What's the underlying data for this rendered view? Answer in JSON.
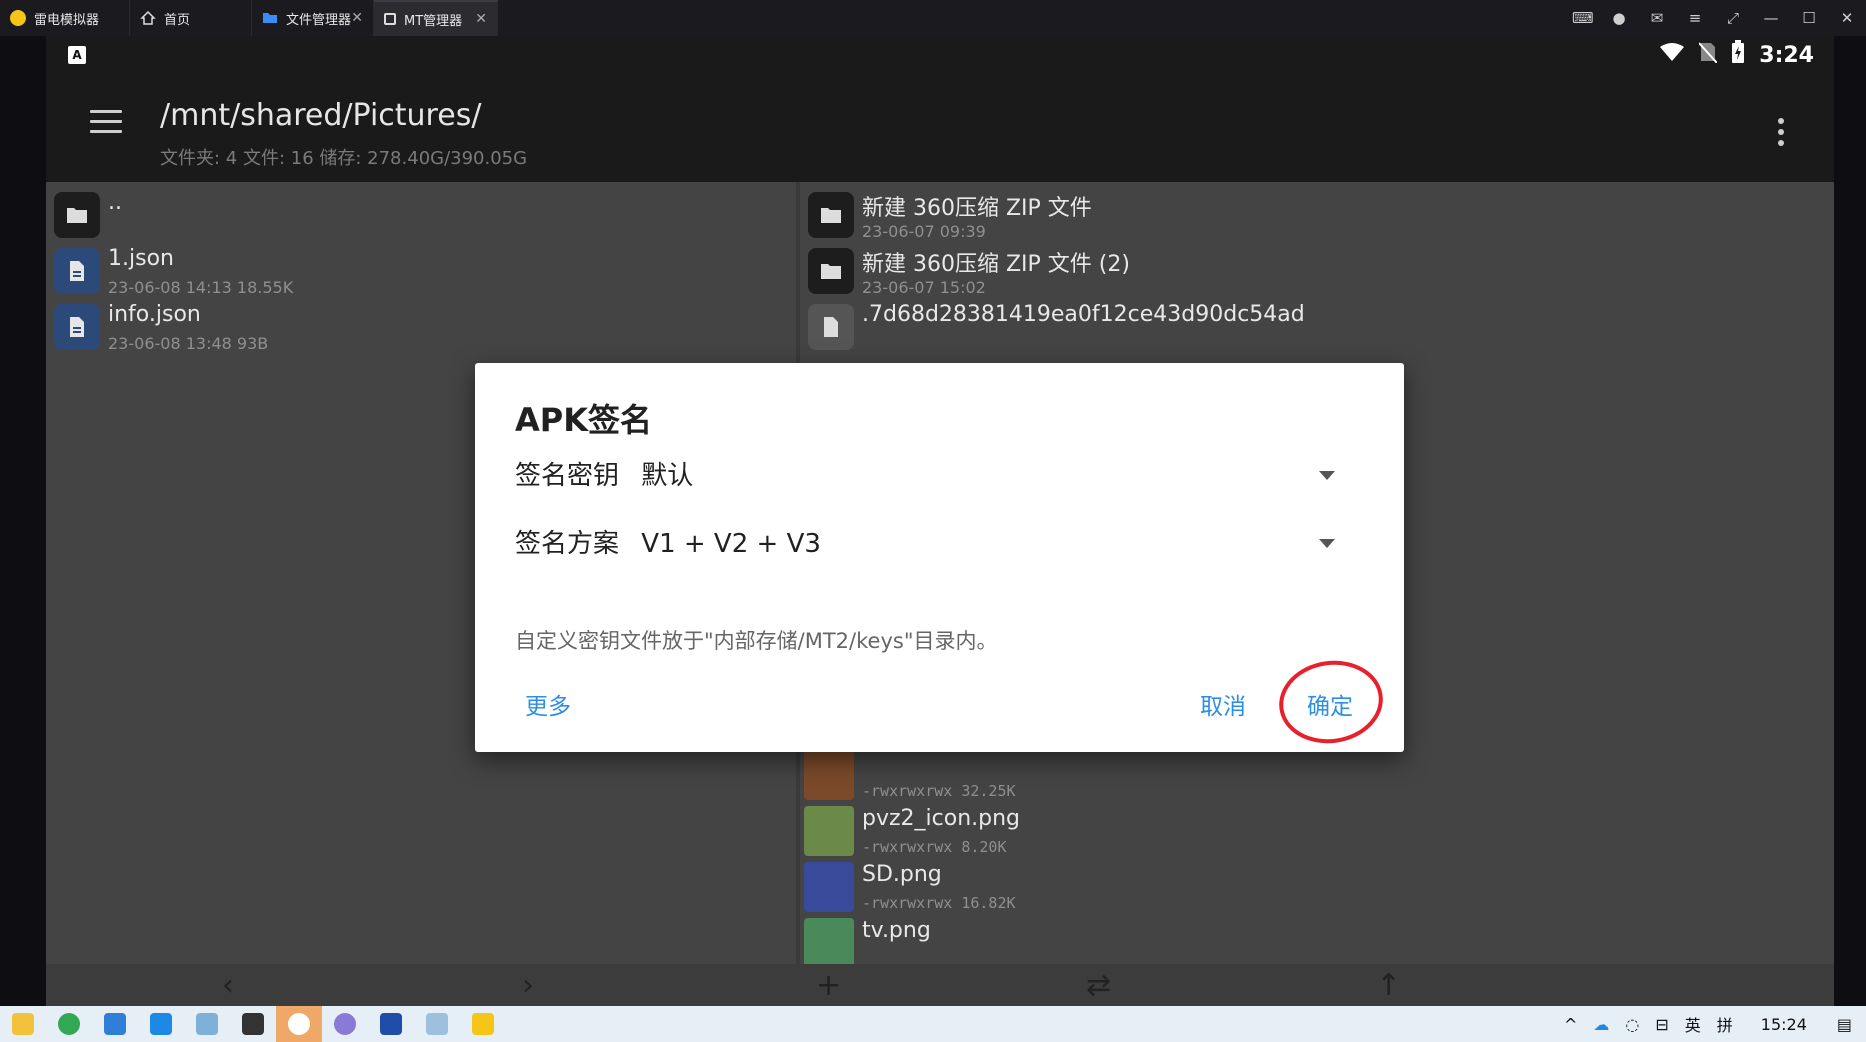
{
  "emulator_tabs": [
    {
      "label": "雷电模拟器",
      "icon": "ldplayer-logo-icon"
    },
    {
      "label": "首页",
      "icon": "home-icon"
    },
    {
      "label": "文件管理器",
      "icon": "folder-icon"
    },
    {
      "label": "MT管理器",
      "icon": "app-icon",
      "active": true
    }
  ],
  "android_status": {
    "time": "3:24"
  },
  "appbar": {
    "path": "/mnt/shared/Pictures/",
    "summary": "文件夹: 4  文件: 16  储存: 278.40G/390.05G"
  },
  "left_pane": [
    {
      "name": "..",
      "meta": "",
      "type": "folder"
    },
    {
      "name": "1.json",
      "meta": "23-06-08 14:13  18.55K",
      "type": "doc"
    },
    {
      "name": "info.json",
      "meta": "23-06-08 13:48  93B",
      "type": "doc"
    }
  ],
  "right_pane_top": [
    {
      "name": "新建 360压缩 ZIP 文件",
      "meta": "23-06-07 09:39",
      "type": "folder"
    },
    {
      "name": "新建 360压缩 ZIP 文件 (2)",
      "meta": "23-06-07 15:02",
      "type": "folder"
    },
    {
      "name": ".7d68d28381419ea0f12ce43d90dc54ad",
      "meta": "",
      "type": "doc"
    }
  ],
  "right_pane_bottom": [
    {
      "name": "",
      "meta": "-rwxrwxrwx  32.25K",
      "thumb": "#7a4a2a"
    },
    {
      "name": "pvz2_icon.png",
      "meta": "-rwxrwxrwx  8.20K",
      "thumb": "#6b8a4a"
    },
    {
      "name": "SD.png",
      "meta": "-rwxrwxrwx  16.82K",
      "thumb": "#3a4a9a"
    },
    {
      "name": "tv.png",
      "meta": "",
      "thumb": "#4a8a5a"
    }
  ],
  "dialog": {
    "title": "APK签名",
    "key_label": "签名密钥",
    "key_value": "默认",
    "scheme_label": "签名方案",
    "scheme_value": "V1 + V2 + V3",
    "note": "自定义密钥文件放于\"内部存储/MT2/keys\"目录内。",
    "more": "更多",
    "cancel": "取消",
    "ok": "确定"
  },
  "taskbar": {
    "ime": "英",
    "ime2": "拼",
    "clock": "15:24"
  },
  "colors": {
    "accent": "#2d8ee6",
    "annotation": "#e8202a"
  }
}
